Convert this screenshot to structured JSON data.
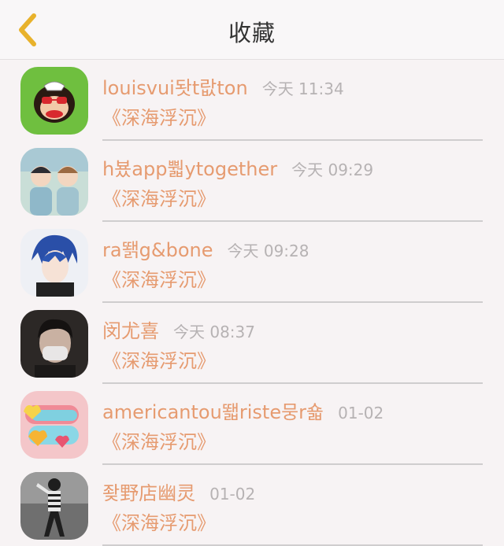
{
  "header": {
    "title": "收藏",
    "back_icon": "chevron-left-icon",
    "accent_color": "#e8b22c"
  },
  "favorites": [
    {
      "username": "louisvui돳t랎ton",
      "time": "今天 11:34",
      "subject": "《深海浮沉》",
      "avatar": "monkey-logo-avatar"
    },
    {
      "username": "h뵸app뿳ytogether",
      "time": "今天 09:29",
      "subject": "《深海浮沉》",
      "avatar": "anime-boys-avatar"
    },
    {
      "username": "ra뙑g&bone",
      "time": "今天 09:28",
      "subject": "《深海浮沉》",
      "avatar": "blue-hair-anime-avatar"
    },
    {
      "username": "闵尤喜",
      "time": "今天 08:37",
      "subject": "《深海浮沉》",
      "avatar": "masked-person-avatar"
    },
    {
      "username": "americantou뙓riste뭉r숇",
      "time": "01-02",
      "subject": "《深海浮沉》",
      "avatar": "colorful-candy-avatar"
    },
    {
      "username": "좢野店幽灵",
      "time": "01-02",
      "subject": "《深海浮沉》",
      "avatar": "bw-dancer-avatar"
    }
  ],
  "colors": {
    "username": "#e69b70",
    "time": "#b6b2b3",
    "background": "#f7f3f4"
  }
}
